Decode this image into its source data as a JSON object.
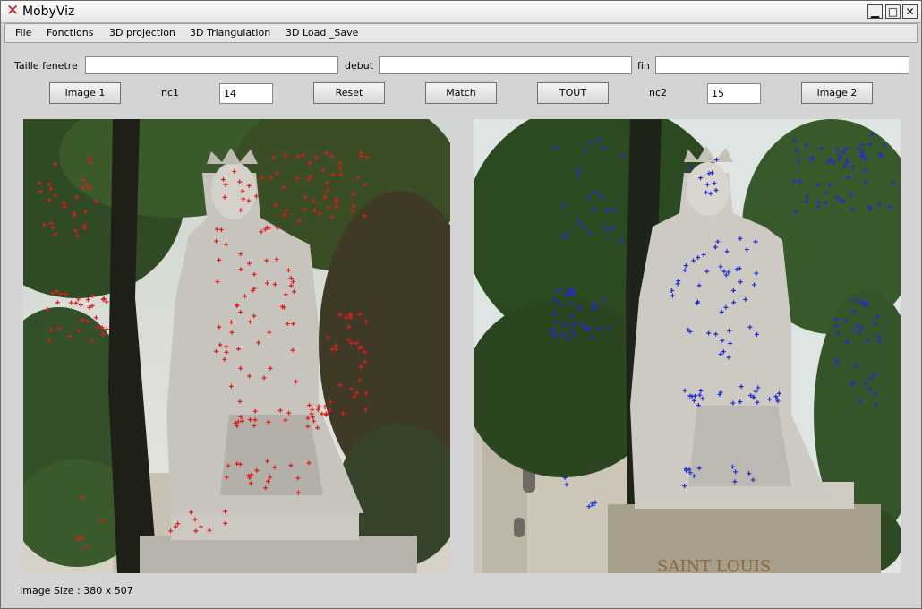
{
  "window": {
    "title": "MobyViz",
    "colors": {
      "accent": "#d01818"
    }
  },
  "menu": [
    "File",
    "Fonctions",
    "3D projection",
    "3D Triangulation",
    "3D Load _Save"
  ],
  "controls": {
    "taille_label": "Taille fenetre",
    "debut_label": "debut",
    "fin_label": "fin",
    "taille_value": "",
    "debut_value": "",
    "fin_value": "",
    "image1_button": "image 1",
    "nc1_label": "nc1",
    "nc1_value": "14",
    "reset_button": "Reset",
    "match_button": "Match",
    "tout_button": "TOUT",
    "nc2_label": "nc2",
    "nc2_value": "15",
    "image2_button": "image 2"
  },
  "images": {
    "left": {
      "marker_color": "#e11a1a",
      "scene": "statue-with-trees"
    },
    "right": {
      "marker_color": "#1f2bd6",
      "inscription": "SAINT LOUIS"
    }
  },
  "status": {
    "image_size": "Image Size : 380 x 507"
  }
}
